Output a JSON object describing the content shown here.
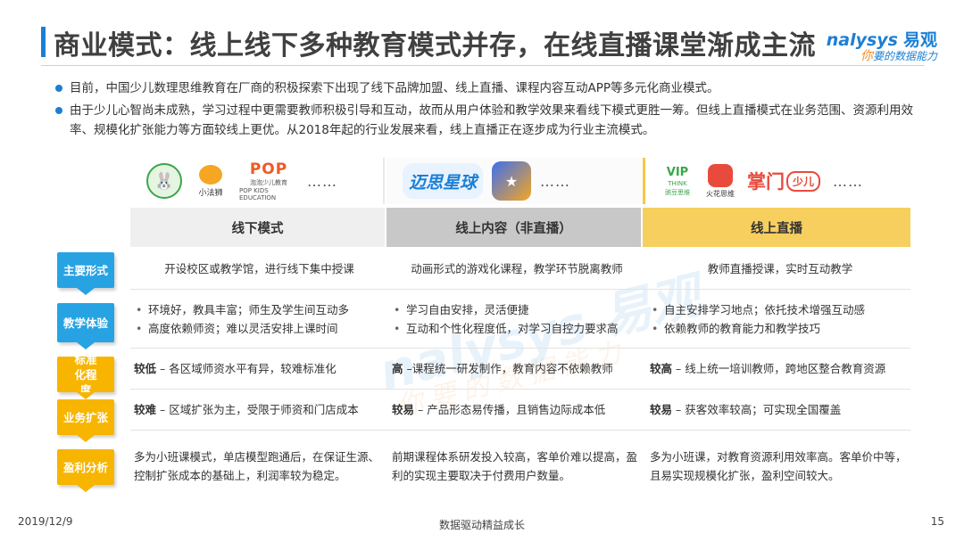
{
  "header": {
    "title": "商业模式：线上线下多种教育模式并存，在线直播课堂渐成主流",
    "logo_en": "nalysys",
    "logo_cn": "易观",
    "logo_slogan_ni": "你",
    "logo_slogan_rest": "要的数据能力"
  },
  "bullets": [
    "目前，中国少儿数理思维教育在厂商的积极探索下出现了线下品牌加盟、线上直播、课程内容互动APP等多元化商业模式。",
    "由于少儿心智尚未成熟，学习过程中更需要教师积极引导和互动，故而从用户体验和教学效果来看线下模式更胜一筹。但线上直播模式在业务范围、资源利用效率、规模化扩张能力等方面较线上更优。从2018年起的行业发展来看，线上直播正在逐步成为行业主流模式。"
  ],
  "logos": {
    "offline": [
      "小法狮",
      "泡泡少儿教育",
      "POP",
      "POP KIDS EDUCATION"
    ],
    "content": [
      "迈思星球"
    ],
    "live": [
      "VIP",
      "THINK",
      "豌豆思维",
      "火花思维",
      "掌门",
      "少儿"
    ],
    "ellipsis": "……"
  },
  "columns": [
    "线下模式",
    "线上内容（非直播）",
    "线上直播"
  ],
  "rows": [
    {
      "label": "主要形式",
      "c1": "开设校区或教学馆，进行线下集中授课",
      "c2": "动画形式的游戏化课程，教学环节脱离教师",
      "c3": "教师直播授课，实时互动教学"
    },
    {
      "label": "教学体验",
      "c1": [
        "环境好，教具丰富；师生及学生间互动多",
        "高度依赖师资；难以灵活安排上课时间"
      ],
      "c2": [
        "学习自由安排，灵活便捷",
        "互动和个性化程度低，对学习自控力要求高"
      ],
      "c3": [
        "自主安排学习地点；依托技术增强互动感",
        "依赖教师的教育能力和教学技巧"
      ]
    },
    {
      "label": "标准化程度",
      "c1_key": "较低",
      "c1": " – 各区域师资水平有异，较难标准化",
      "c2_key": "高",
      "c2": " –课程统一研发制作，教育内容不依赖教师",
      "c3_key": "较高",
      "c3": " – 线上统一培训教师，跨地区整合教育资源"
    },
    {
      "label": "业务扩张",
      "c1_key": "较难",
      "c1": " – 区域扩张为主，受限于师资和门店成本",
      "c2_key": "较易",
      "c2": " – 产品形态易传播，且销售边际成本低",
      "c3_key": "较易",
      "c3": " – 获客效率较高；可实现全国覆盖"
    },
    {
      "label": "盈利分析",
      "c1": "多为小班课模式，单店模型跑通后，在保证生源、控制扩张成本的基础上，利润率较为稳定。",
      "c2": "前期课程体系研发投入较高，客单价难以提高，盈利的实现主要取决于付费用户数量。",
      "c3": "多为小班课，对教育资源利用效率高。客单价中等，且易实现规模化扩张，盈利空间较大。"
    }
  ],
  "footer": {
    "date": "2019/12/9",
    "center": "数据驱动精益成长",
    "page": "15"
  },
  "colors": {
    "accent_blue": "#1b7fd4",
    "tag_blue": "#27a3e3",
    "tag_orange": "#f7b500",
    "live_header": "#f7cf5e"
  }
}
